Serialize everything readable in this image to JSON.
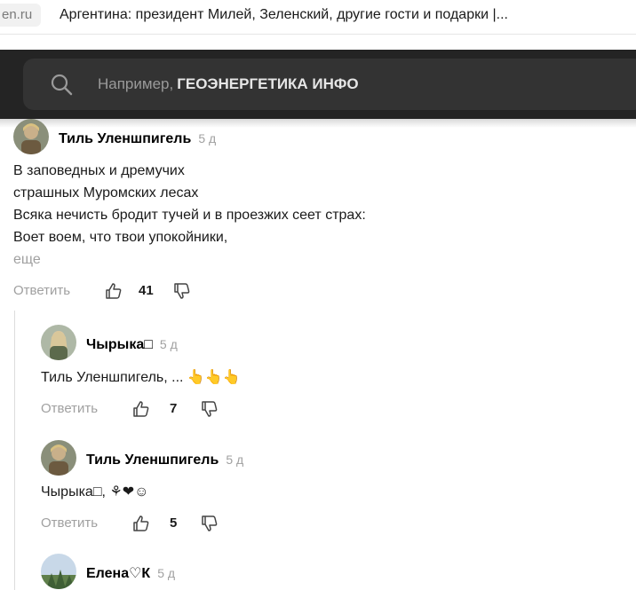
{
  "tab": {
    "domain": "en.ru",
    "title": "Аргентина: президент Милей, Зеленский, другие гости и подарки |..."
  },
  "search": {
    "placeholder_prefix": "Например,",
    "placeholder_suggestion": "ГЕОЭНЕРГЕТИКА ИНФО"
  },
  "comments": [
    {
      "author": "Тиль Уленшпигель",
      "time": "5 д",
      "lines": [
        "В заповедных и дремучих",
        "страшных Муромских лесах",
        "Всяка нечисть бродит тучей и в проезжих сеет страх:",
        "Воет воем, что твои упокойники,"
      ],
      "more": "еще",
      "reply": "Ответить",
      "likes": "41"
    },
    {
      "author": "Чырыка□",
      "time": "5 д",
      "text": "Тиль Уленшпигель, ... 👆👆👆",
      "reply": "Ответить",
      "likes": "7"
    },
    {
      "author": "Тиль Уленшпигель",
      "time": "5 д",
      "text": "Чырыка□, ⚘❤☺",
      "reply": "Ответить",
      "likes": "5"
    },
    {
      "author": "Елена♡К",
      "time": "5 д"
    }
  ]
}
